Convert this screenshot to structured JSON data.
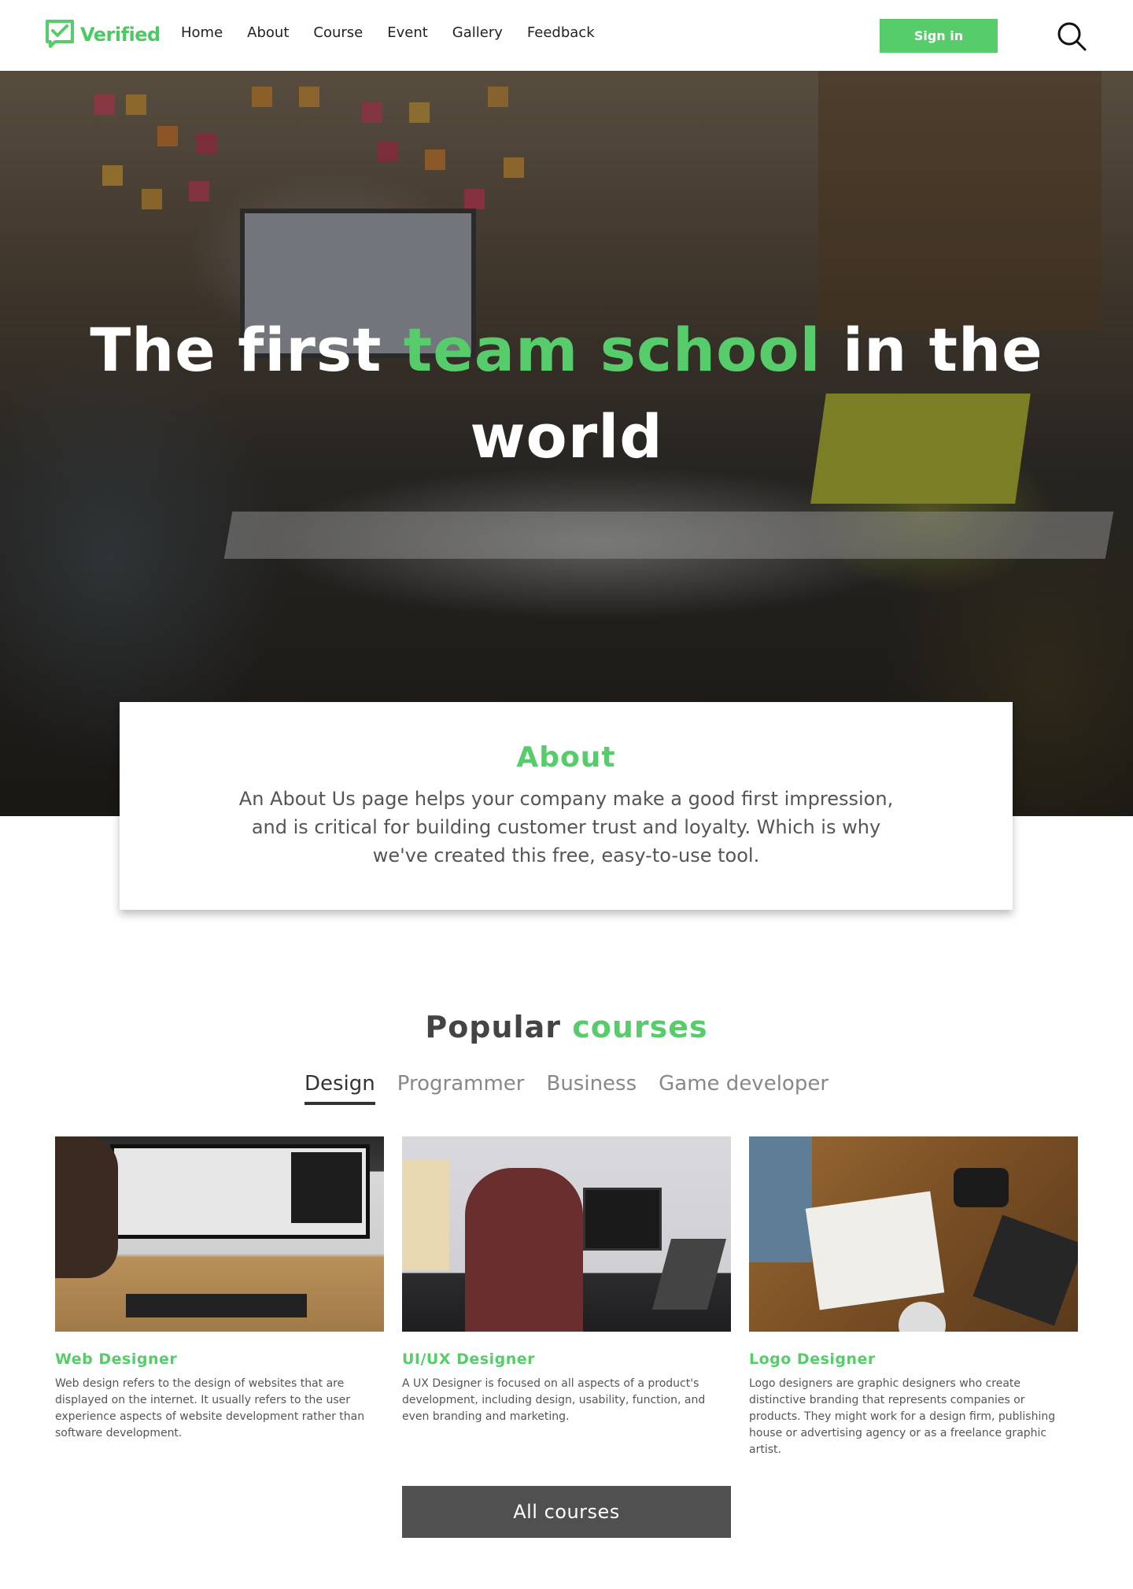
{
  "brand": {
    "name": "Verified",
    "logo_icon": "check-chat-icon",
    "accent": "#56cc6a"
  },
  "nav": {
    "links": [
      "Home",
      "About",
      "Course",
      "Event",
      "Gallery",
      "Feedback"
    ],
    "signin_label": "Sign in",
    "search_icon": "search-icon"
  },
  "hero": {
    "title_before": "The first ",
    "title_highlight": "team school",
    "title_after": " in the world"
  },
  "about": {
    "title": "About",
    "text": "An About Us page helps your company make a good first impression, and is critical for building customer trust and loyalty. Which is why we've created this free, easy-to-use tool."
  },
  "courses": {
    "heading_plain": "Popular ",
    "heading_highlight": "courses",
    "tabs": [
      "Design",
      "Programmer",
      "Business",
      "Game developer"
    ],
    "active_tab": "Design",
    "items": [
      {
        "title": "Web Designer",
        "description": "Web design refers to the design of websites that are displayed on the internet. It usually refers to the user experience aspects of website development rather than software development."
      },
      {
        "title": "UI/UX Designer",
        "description": "A UX Designer is focused on all aspects of a product's development, including design, usability, function, and even branding and marketing."
      },
      {
        "title": "Logo Designer",
        "description": "Logo designers are graphic designers who create distinctive branding that represents companies or products. They might work for a design firm, publishing house or advertising agency or as a freelance graphic artist."
      }
    ],
    "all_button": "All courses"
  }
}
